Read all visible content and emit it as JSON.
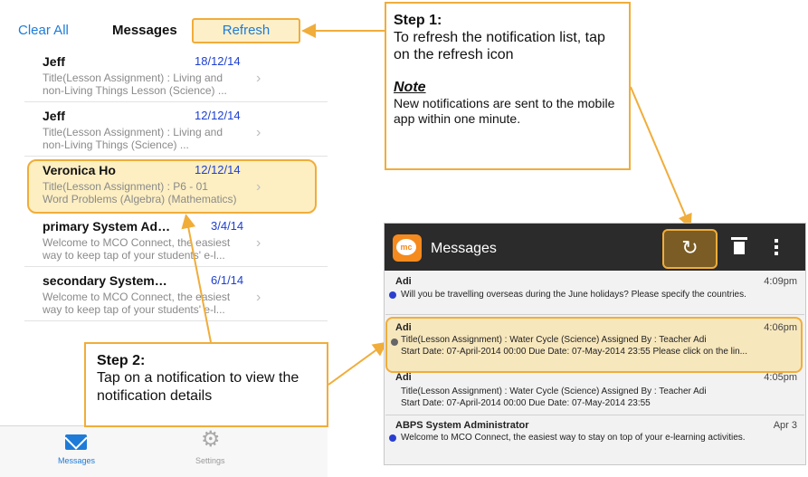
{
  "ios": {
    "clear_all": "Clear All",
    "title": "Messages",
    "refresh": "Refresh",
    "rows": [
      {
        "name": "Jeff",
        "date": "18/12/14",
        "l1": "Title(Lesson Assignment) : Living and",
        "l2": "non-Living Things Lesson (Science) ..."
      },
      {
        "name": "Jeff",
        "date": "12/12/14",
        "l1": "Title(Lesson Assignment) : Living and",
        "l2": "non-Living Things (Science) ..."
      },
      {
        "name": "Veronica Ho",
        "date": "12/12/14",
        "l1": "Title(Lesson Assignment) : P6 - 01",
        "l2": "Word Problems (Algebra) (Mathematics)"
      },
      {
        "name": "primary System Ad…",
        "date": "3/4/14",
        "l1": "Welcome to MCO Connect, the easiest",
        "l2": "way to keep tap of your students' e-l..."
      },
      {
        "name": "secondary System…",
        "date": "6/1/14",
        "l1": "Welcome to MCO Connect, the easiest",
        "l2": "way to keep tap of your students' e-l..."
      }
    ],
    "tabs": {
      "messages": "Messages",
      "settings": "Settings"
    }
  },
  "step1": {
    "heading": "Step 1:",
    "text": "To refresh the notification list, tap on the refresh icon",
    "note_heading": "Note",
    "note_text": "New notifications are sent to the mobile app within one minute."
  },
  "step2": {
    "heading": "Step 2:",
    "text": "Tap on a notification to view the notification details"
  },
  "android": {
    "title": "Messages",
    "logo_text": "mc",
    "rows": [
      {
        "who": "Adi",
        "time": "4:09pm",
        "l1": "Will you be travelling overseas during the June holidays? Please specify the countries.",
        "l2": ""
      },
      {
        "who": "Adi",
        "time": "4:06pm",
        "l1": "Title(Lesson Assignment) : Water Cycle (Science)  Assigned By : Teacher Adi",
        "l2": "Start Date: 07-April-2014 00:00 Due Date: 07-May-2014 23:55  Please click on the lin..."
      },
      {
        "who": "Adi",
        "time": "4:05pm",
        "l1": "Title(Lesson Assignment) : Water Cycle (Science)  Assigned By : Teacher Adi",
        "l2": "Start Date: 07-April-2014 00:00 Due Date: 07-May-2014 23:55"
      },
      {
        "who": "ABPS System Administrator",
        "time": "Apr 3",
        "l1": "Welcome to MCO Connect, the easiest way to stay on top of your e-learning activities.",
        "l2": ""
      }
    ]
  },
  "colors": {
    "accent": "#f0ad3a",
    "highlight": "#fdefc2",
    "ios_blue": "#1e7bd8",
    "android_bar": "#2b2b2b"
  }
}
